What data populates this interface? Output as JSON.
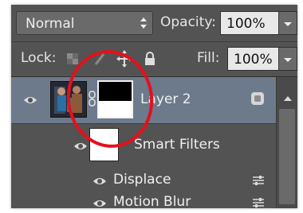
{
  "options_bar": {
    "blend_mode": "Normal",
    "opacity_label": "Opacity:",
    "opacity_value": "100%"
  },
  "lock_bar": {
    "lock_label": "Lock:",
    "fill_label": "Fill:",
    "fill_value": "100%"
  },
  "layers": {
    "layer_name": "Layer 2",
    "smart_filters_label": "Smart Filters",
    "filters": [
      {
        "label": "Displace"
      },
      {
        "label": "Motion Blur"
      }
    ]
  },
  "colors": {
    "panel_bg": "#535353",
    "selected_row": "#6c7a8c",
    "annotation_red": "#e4101c"
  },
  "icons": [
    "eye-icon",
    "chain-link-icon",
    "lock-transparent-pixels-icon",
    "lock-image-pixels-icon",
    "lock-position-icon",
    "lock-all-icon",
    "smart-object-icon",
    "filter-options-icon"
  ]
}
